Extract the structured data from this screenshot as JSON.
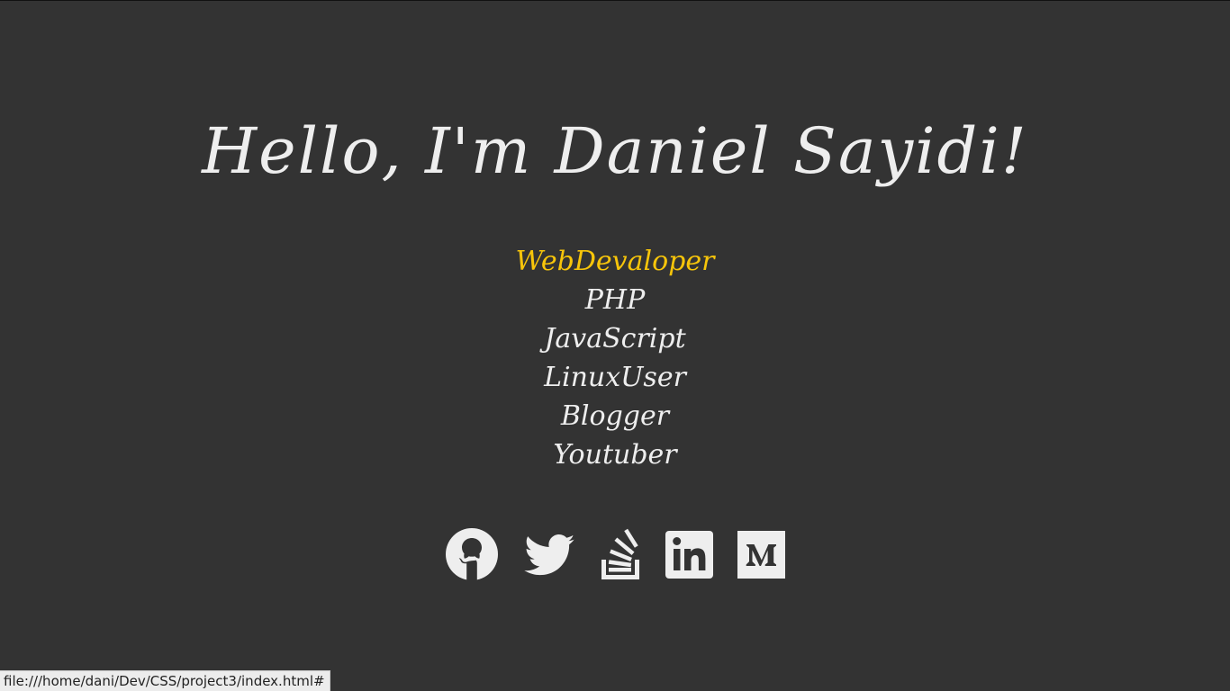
{
  "hero": {
    "title": "Hello, I'm Daniel Sayidi!"
  },
  "roles": [
    {
      "label": "WebDevaloper",
      "active": true
    },
    {
      "label": "PHP",
      "active": false
    },
    {
      "label": "JavaScript",
      "active": false
    },
    {
      "label": "LinuxUser",
      "active": false
    },
    {
      "label": "Blogger",
      "active": false
    },
    {
      "label": "Youtuber",
      "active": false
    }
  ],
  "social_links": [
    {
      "icon": "github-icon"
    },
    {
      "icon": "twitter-icon"
    },
    {
      "icon": "stack-overflow-icon"
    },
    {
      "icon": "linkedin-icon"
    },
    {
      "icon": "medium-icon"
    }
  ],
  "status_bar": {
    "url": "file:///home/dani/Dev/CSS/project3/index.html#"
  },
  "colors": {
    "background": "#333333",
    "text": "#eeeeee",
    "accent": "#f7c50a"
  }
}
